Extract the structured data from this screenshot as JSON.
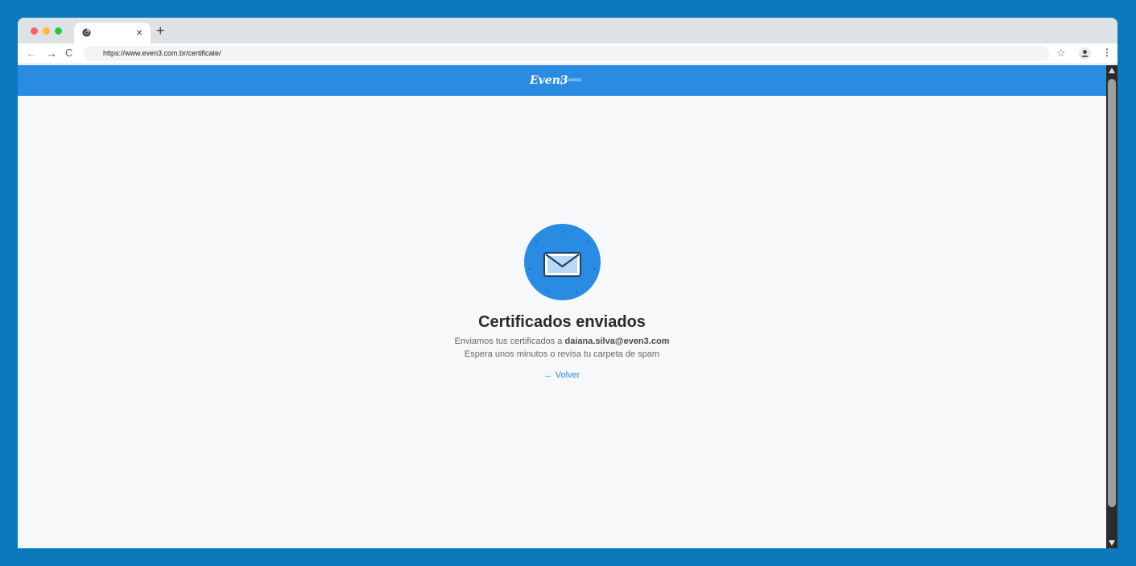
{
  "browser": {
    "tab": {
      "favicon": "chrome-logo-icon",
      "close_glyph": "×"
    },
    "new_tab_glyph": "+",
    "nav": {
      "back_glyph": "←",
      "forward_glyph": "→",
      "reload_glyph": "C"
    },
    "url": "https://www.even3.com.br/certificate/",
    "icons": {
      "star": "☆",
      "profile": "profile-icon",
      "menu": "⋮"
    }
  },
  "header": {
    "logo": "Even3",
    "logo_sub": "Eventos",
    "background": "#2a8be3"
  },
  "main": {
    "icon": "envelope-icon",
    "title": "Certificados enviados",
    "line1_prefix": "Enviamos tus certificados a ",
    "email": "daiana.silva@even3.com",
    "line2": "Espera unos minutos o revisa tu carpeta de spam",
    "back_label": "← Volver",
    "accent": "#2a8be3"
  }
}
